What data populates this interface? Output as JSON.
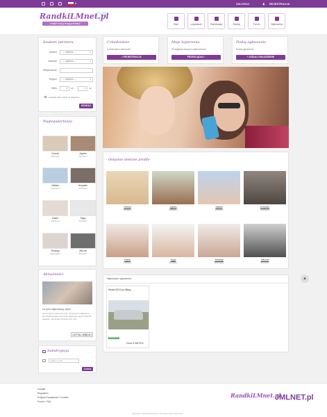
{
  "topbar": {
    "login_label": "ZALOGUJ",
    "register_label": "REJESTRACJA"
  },
  "logo": {
    "title": "RandkiLMnet.pl",
    "tagline": "znajdź swoją drugą połówkę!"
  },
  "nav": [
    {
      "label": "Start",
      "icon": "home-icon"
    },
    {
      "label": "Logowanie",
      "icon": "user-icon"
    },
    {
      "label": "Rejestracja",
      "icon": "user-plus-icon"
    },
    {
      "label": "Szukaj",
      "icon": "search-icon"
    },
    {
      "label": "Forum",
      "icon": "comments-icon"
    },
    {
      "label": "Ogłoszenia",
      "icon": "list-icon"
    }
  ],
  "search_panel": {
    "title": "Szukam partnera",
    "fields": [
      {
        "label": "Jestem",
        "value": "— wybierz —"
      },
      {
        "label": "Szukam",
        "value": "— wybierz —"
      },
      {
        "label": "Miejscowość",
        "value": ""
      },
      {
        "label": "Region",
        "value": "— wybierz —"
      },
      {
        "label": "Wiek",
        "from": "od",
        "to": "do"
      }
    ],
    "photo_only_label": "wyświetl tylko profile ze zdjęciem",
    "submit_label": "SZUKAJ"
  },
  "popular": {
    "title": "Najpopularniejsi",
    "people": [
      {
        "name": "Karola",
        "city": "Szczecin"
      },
      {
        "name": "Agnes",
        "city": "Szczecin"
      },
      {
        "name": "Malika",
        "city": "Szczecin"
      },
      {
        "name": "Krzysiek",
        "city": "Szczecin"
      },
      {
        "name": "Kasia",
        "city": "Szczecin"
      },
      {
        "name": "Zyga",
        "city": "Szczecin"
      },
      {
        "name": "Tosiowy",
        "city": "Warszawa"
      },
      {
        "name": "JMLnet",
        "city": "Szczecin"
      }
    ]
  },
  "news": {
    "title": "Aktualności",
    "headline": "co jest najnowszy wpis",
    "body": "Lorem ipsum dolor sit amet, consectetur adipiscing elit. Pellentesque nunc ante, dignissim eget hendrerit egestas, accumsan sit amet nisl. Fus...",
    "more_label": "CZYTAJ WIĘCEJ"
  },
  "newsletter": {
    "title": "Subskrypcja",
    "placeholder": "Adres e-mail",
    "button_label": "ZAPISZ"
  },
  "info_boxes": [
    {
      "title": "Członkostwo",
      "desc": "Członkostwo darmowe!",
      "button": "REJESTRACJA"
    },
    {
      "title": "Moje kojarzenia",
      "desc": "Przeglądaj naszych użytkowników",
      "button": "PRZEGLĄDAJ"
    },
    {
      "title": "Dodaj ogłoszenie",
      "desc": "Dodaj ogłoszenie",
      "button": "DODAJ OGŁOSZENIE"
    }
  ],
  "recent": {
    "title": "Ostatnio dodane profile",
    "profiles": [
      {
        "name": "Karola",
        "city": "Szczecin"
      },
      {
        "name": "Agnes",
        "city": "Szczecin"
      },
      {
        "name": "Malika",
        "city": "Szczecin"
      },
      {
        "name": "Krzysiek",
        "city": "Szczecin"
      },
      {
        "name": "Kasia",
        "city": "Szczecin"
      },
      {
        "name": "Zyga",
        "city": "Szczecin"
      },
      {
        "name": "Tosiowy",
        "city": "Warszawa"
      },
      {
        "name": "JMLnet",
        "city": "Szczecin"
      }
    ]
  },
  "ads": {
    "title": "Najnowsze ogłoszenia",
    "item_title": "Model 2013 po lifting...",
    "badge": "SPRZEDAM",
    "price_label": "Cena: 9 950 PLN"
  },
  "footer": {
    "links": [
      "Kontakt",
      "Regulamin",
      "Polityka Prywatności i Cookies",
      "Pomoc / FAQ"
    ],
    "copyright": "Copyright © 2016 RandkiLMnet.pl. Wszelkie prawa zastrzeżone.",
    "partner_logo": "JMLNET.pl"
  },
  "colors": {
    "accent": "#7d3b96",
    "logo_blue": "#5fb7e6"
  }
}
